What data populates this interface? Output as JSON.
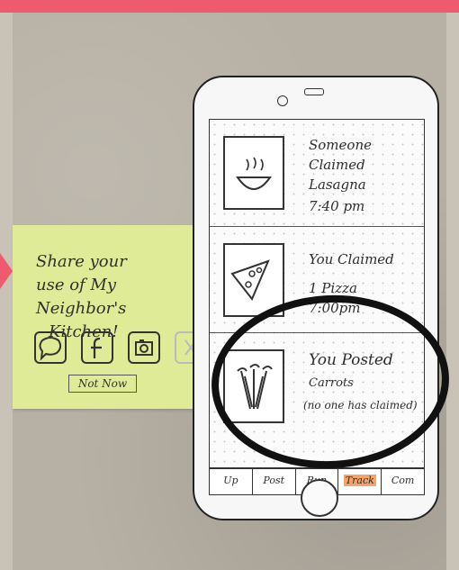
{
  "sticky": {
    "title_lines": [
      "Share your",
      "use of My Neighbor's",
      "Kitchen!"
    ],
    "share_icons": [
      "speech-bubble-icon",
      "facebook-icon",
      "camera-icon",
      "close-icon"
    ],
    "not_now": "Not Now"
  },
  "feed": [
    {
      "icon": "bowl-icon",
      "lines": [
        "Someone",
        "Claimed",
        "Lasagna",
        "7:40 pm"
      ]
    },
    {
      "icon": "pizza-icon",
      "lines": [
        "You Claimed",
        "1 Pizza",
        "7:00pm"
      ]
    },
    {
      "icon": "carrots-icon",
      "lines": [
        "You Posted",
        "Carrots",
        "(no one has claimed)"
      ]
    }
  ],
  "tabs": [
    "Up",
    "Post",
    "Run",
    "Track",
    "Com"
  ],
  "active_tab": "Track",
  "colors": {
    "accent": "#ee5a6e",
    "sticky": "#dfeb97",
    "tab_highlight": "#f4a36a",
    "ink": "#2f2f2f"
  }
}
